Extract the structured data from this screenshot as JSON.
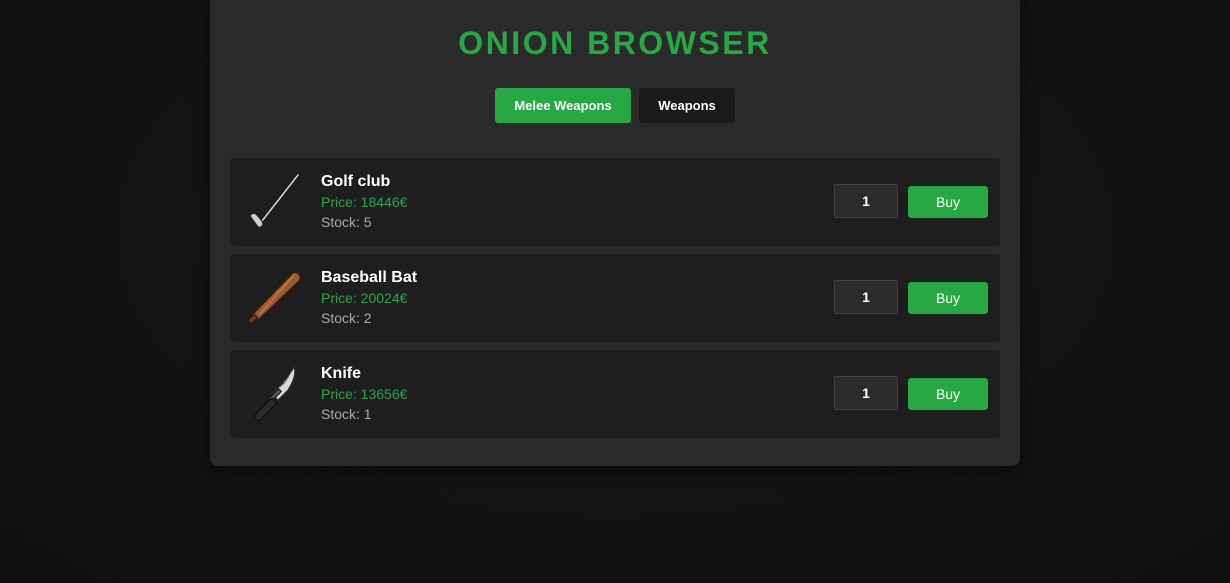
{
  "app": {
    "title": "ONION BROWSER",
    "accent_color": "#28a745"
  },
  "tabs": [
    {
      "label": "Melee Weapons",
      "active": true
    },
    {
      "label": "Weapons",
      "active": false
    }
  ],
  "items": [
    {
      "name": "Golf club",
      "price": "Price: 18446€",
      "stock": "Stock: 5",
      "quantity": "1",
      "buy_label": "Buy",
      "icon": "golf-club-icon"
    },
    {
      "name": "Baseball Bat",
      "price": "Price: 20024€",
      "stock": "Stock: 2",
      "quantity": "1",
      "buy_label": "Buy",
      "icon": "baseball-bat-icon"
    },
    {
      "name": "Knife",
      "price": "Price: 13656€",
      "stock": "Stock: 1",
      "quantity": "1",
      "buy_label": "Buy",
      "icon": "knife-icon"
    }
  ]
}
